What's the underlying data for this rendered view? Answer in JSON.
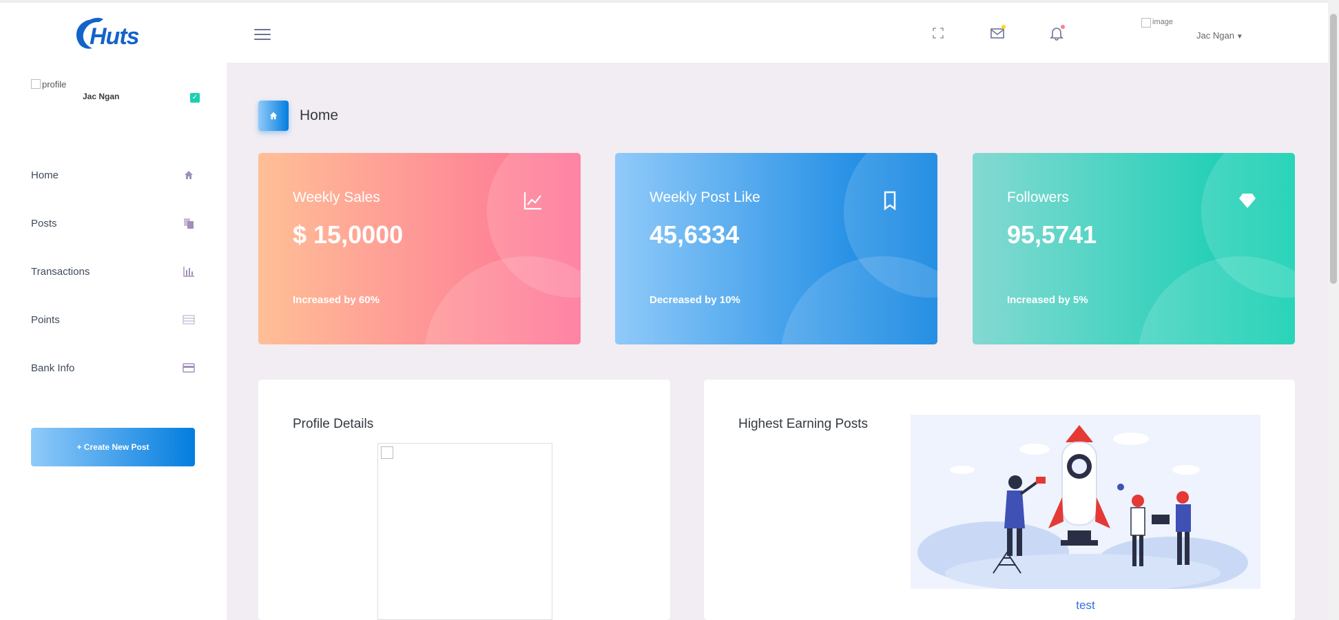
{
  "brand": {
    "logo_text": "Huts",
    "color": "#1463c9"
  },
  "topbar": {
    "user_image_alt": "image",
    "user_name": "Jac Ngan",
    "icons": [
      "fullscreen-icon",
      "mail-icon",
      "bell-icon"
    ]
  },
  "sidebar": {
    "profile_alt": "profile",
    "profile_name": "Jac Ngan",
    "items": [
      {
        "label": "Home",
        "icon": "home-icon"
      },
      {
        "label": "Posts",
        "icon": "posts-icon"
      },
      {
        "label": "Transactions",
        "icon": "bar-chart-icon"
      },
      {
        "label": "Points",
        "icon": "list-icon"
      },
      {
        "label": "Bank Info",
        "icon": "card-icon"
      }
    ],
    "create_button": "+ Create New Post"
  },
  "page": {
    "title": "Home"
  },
  "stats": [
    {
      "label": "Weekly Sales",
      "value": "$ 15,0000",
      "sub": "Increased by 60%",
      "icon": "chart-line-icon",
      "gradient": [
        "#ffbf96",
        "#fe7096"
      ]
    },
    {
      "label": "Weekly Post Like",
      "value": "45,6334",
      "sub": "Decreased by 10%",
      "icon": "bookmark-icon",
      "gradient": [
        "#90caf9",
        "#047edf"
      ]
    },
    {
      "label": "Followers",
      "value": "95,5741",
      "sub": "Increased by 5%",
      "icon": "diamond-icon",
      "gradient": [
        "#84d9d2",
        "#07cdae"
      ]
    }
  ],
  "panels": {
    "profile_title": "Profile Details",
    "earning_title": "Highest Earning Posts",
    "earning_caption": "test"
  }
}
